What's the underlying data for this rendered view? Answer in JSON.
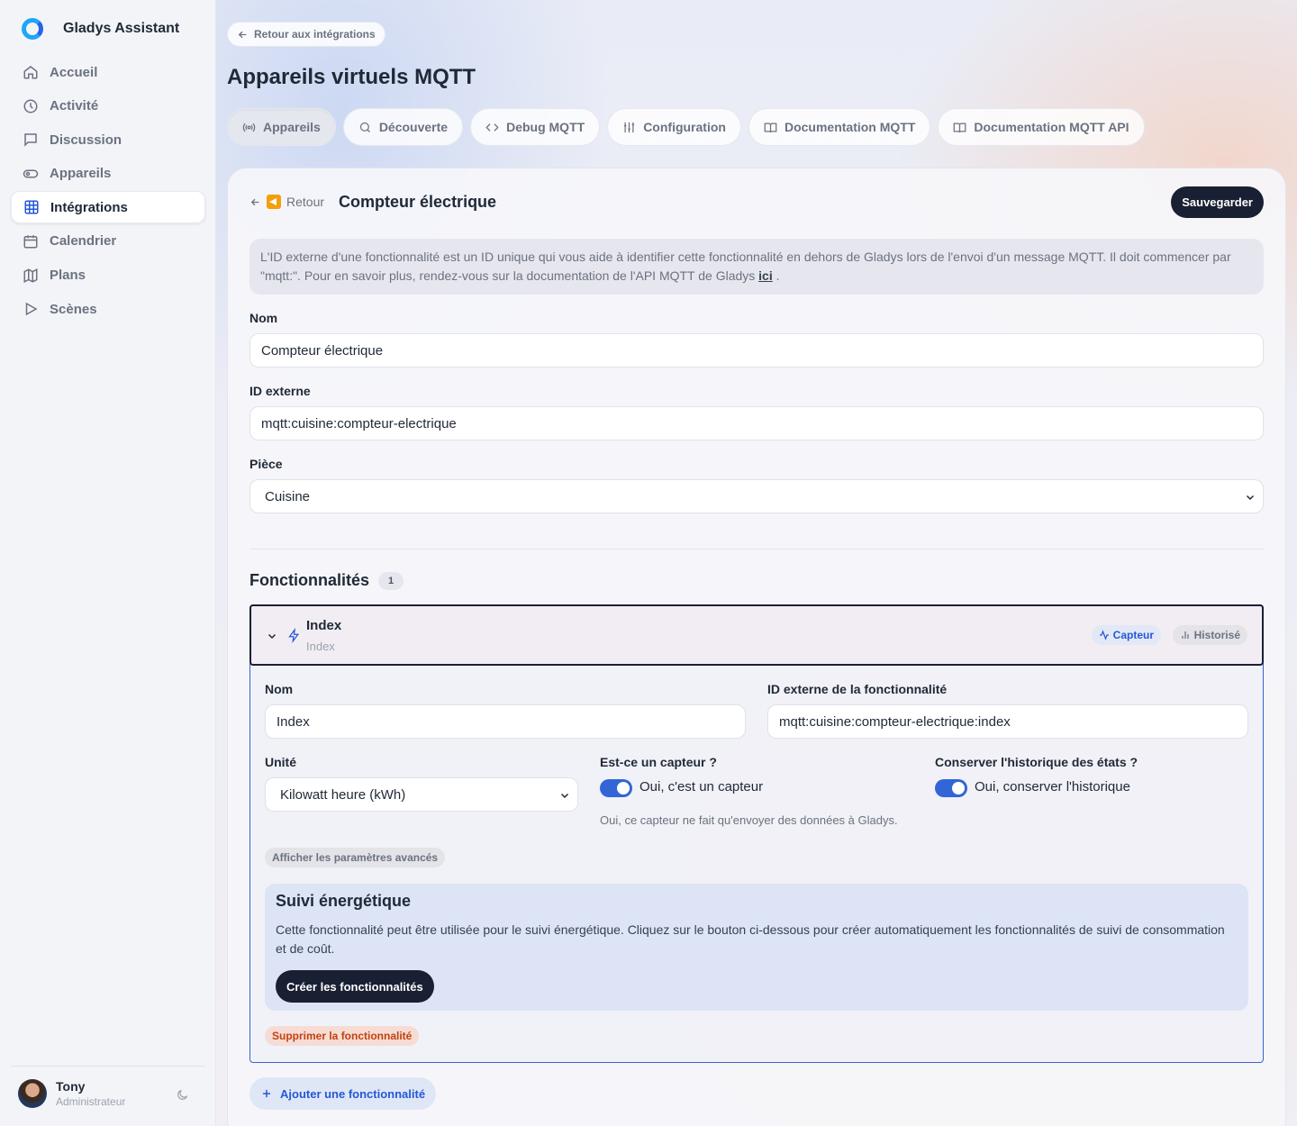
{
  "app": {
    "name": "Gladys Assistant"
  },
  "sidebar": {
    "items": [
      {
        "label": "Accueil",
        "icon": "home-icon"
      },
      {
        "label": "Activité",
        "icon": "clock-icon"
      },
      {
        "label": "Discussion",
        "icon": "message-icon"
      },
      {
        "label": "Appareils",
        "icon": "toggle-icon"
      },
      {
        "label": "Intégrations",
        "icon": "grid-icon",
        "active": true
      },
      {
        "label": "Calendrier",
        "icon": "calendar-icon"
      },
      {
        "label": "Plans",
        "icon": "map-icon"
      },
      {
        "label": "Scènes",
        "icon": "play-icon"
      }
    ],
    "user": {
      "name": "Tony",
      "role": "Administrateur"
    }
  },
  "header": {
    "back_label": "Retour aux intégrations",
    "title": "Appareils virtuels MQTT",
    "tabs": [
      {
        "label": "Appareils",
        "icon": "broadcast-icon",
        "active": true
      },
      {
        "label": "Découverte",
        "icon": "search-icon"
      },
      {
        "label": "Debug MQTT",
        "icon": "code-icon"
      },
      {
        "label": "Configuration",
        "icon": "sliders-icon"
      },
      {
        "label": "Documentation MQTT",
        "icon": "book-icon"
      },
      {
        "label": "Documentation MQTT API",
        "icon": "book-icon"
      }
    ]
  },
  "device": {
    "back_label": "Retour",
    "title": "Compteur électrique",
    "save_label": "Sauvegarder",
    "info_text": "L'ID externe d'une fonctionnalité est un ID unique qui vous aide à identifier cette fonctionnalité en dehors de Gladys lors de l'envoi d'un message MQTT. Il doit commencer par \"mqtt:\". Pour en savoir plus, rendez-vous sur la documentation de l'API MQTT de Gladys",
    "info_link": "ici",
    "name_label": "Nom",
    "name_value": "Compteur électrique",
    "external_id_label": "ID externe",
    "external_id_value": "mqtt:cuisine:compteur-electrique",
    "room_label": "Pièce",
    "room_value": "Cuisine"
  },
  "features": {
    "title": "Fonctionnalités",
    "count": "1",
    "items": [
      {
        "name": "Index",
        "subtitle": "Index",
        "badge_sensor": "Capteur",
        "badge_history": "Historisé",
        "name_label": "Nom",
        "name_value": "Index",
        "external_id_label": "ID externe de la fonctionnalité",
        "external_id_value": "mqtt:cuisine:compteur-electrique:index",
        "unit_label": "Unité",
        "unit_value": "Kilowatt heure (kWh)",
        "sensor_label": "Est-ce un capteur ?",
        "sensor_toggle_text": "Oui, c'est un capteur",
        "sensor_help": "Oui, ce capteur ne fait qu'envoyer des données à Gladys.",
        "sensor_on": true,
        "history_label": "Conserver l'historique des états ?",
        "history_toggle_text": "Oui, conserver l'historique",
        "history_on": true,
        "advanced_label": "Afficher les paramètres avancés",
        "energy_title": "Suivi énergétique",
        "energy_text": "Cette fonctionnalité peut être utilisée pour le suivi énergétique. Cliquez sur le bouton ci-dessous pour créer automatiquement les fonctionnalités de suivi de consommation et de coût.",
        "energy_button": "Créer les fonctionnalités",
        "delete_label": "Supprimer la fonctionnalité"
      }
    ],
    "add_label": "Ajouter une fonctionnalité"
  },
  "colors": {
    "accent": "#2557d6",
    "dark_button": "#1a2033",
    "danger": "#c2410c"
  }
}
